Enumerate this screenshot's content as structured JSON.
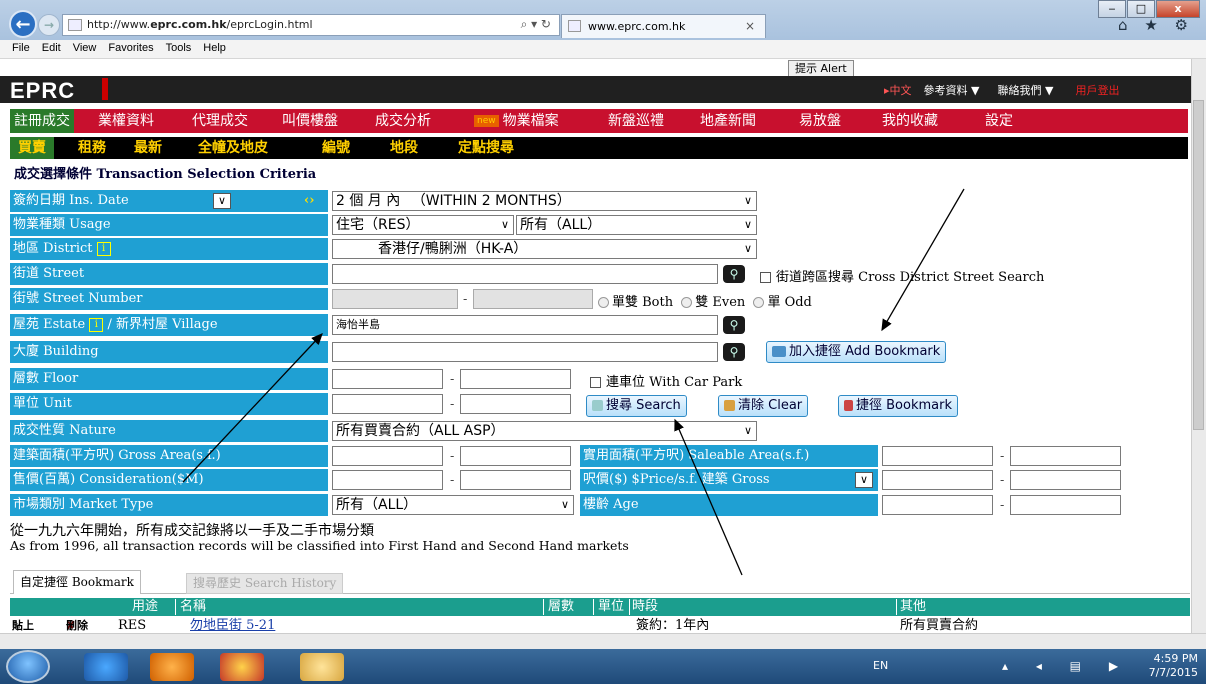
{
  "browser": {
    "url_prefix": "http://www.",
    "url_domain": "eprc.com.hk",
    "url_path": "/eprcLogin.html",
    "search_glyph": "⌕ ▾ ↻",
    "tab_title": "www.eprc.com.hk",
    "tab_close": "×",
    "menu": [
      "File",
      "Edit",
      "View",
      "Favorites",
      "Tools",
      "Help"
    ],
    "window_buttons": [
      "‒",
      "□",
      "x"
    ],
    "toolbar_icons": "⌂ ★ ⚙"
  },
  "header": {
    "logo": "EPRC",
    "alert_button": "提示 Alert",
    "lang_link": "▸中文",
    "ref_menu": "參考資料 ▼",
    "contact_menu": "聯絡我們 ▼",
    "logout": "用戶登出"
  },
  "nav1": {
    "new_badge": "new",
    "items": [
      "註冊成交",
      "業權資料",
      "代理成交",
      "叫價樓盤",
      "成交分析",
      "物業檔案",
      "新盤巡禮",
      "地產新聞",
      "易放盤",
      "我的收藏",
      "設定"
    ]
  },
  "nav2": {
    "items": [
      "買賣",
      "租務",
      "最新",
      "全幢及地皮",
      "編號",
      "地段",
      "定點搜尋"
    ]
  },
  "criteria_title": "成交選擇條件 Transaction Selection Criteria",
  "form": {
    "date_label": "簽約日期 Ins. Date",
    "date_value": "2 個 月 內 　（WITHIN 2 MONTHS）",
    "usage_label": "物業種類 Usage",
    "usage_value1": "住宅（RES）",
    "usage_value2": "所有（ALL）",
    "district_label": "地區 District",
    "district_value": "香港仔/鴨脷洲（HK-A）",
    "street_label": "街道 Street",
    "cross_district": "街道跨區搜尋 Cross District Street Search",
    "street_no_label": "街號 Street Number",
    "radio_both": "單雙 Both",
    "radio_even": "雙 Even",
    "radio_odd": "單 Odd",
    "estate_label_a": "屋苑 Estate",
    "estate_label_b": "/ 新界村屋 Village",
    "estate_value": "海怡半島",
    "building_label": "大廈 Building",
    "add_bookmark": "加入捷徑 Add Bookmark",
    "floor_label": "層數 Floor",
    "car_park": "連車位 With Car Park",
    "unit_label": "單位 Unit",
    "search_btn": "搜尋 Search",
    "clear_btn": "清除 Clear",
    "bookmark_btn": "捷徑 Bookmark",
    "nature_label": "成交性質 Nature",
    "nature_value": "所有買賣合約（ALL ASP）",
    "gross_label": "建築面積(平方呎) Gross Area(s.f.)",
    "saleable_label": "實用面積(平方呎) Saleable Area(s.f.)",
    "consideration_label": "售價(百萬) Consideration($M)",
    "price_label": "呎價($) $Price/s.f. 建築 Gross",
    "market_label": "市場類別 Market Type",
    "market_value": "所有（ALL）",
    "age_label": "樓齡 Age",
    "dash": "-",
    "info_icon_text": "i",
    "arrow_glyph": "∨",
    "swap_glyph": "‹›"
  },
  "note_zh": "從一九九六年開始，所有成交記錄將以一手及二手市場分類",
  "note_en": "As from 1996, all transaction records will be classified into First Hand and Second Hand markets",
  "tabs": {
    "bookmark": "自定捷徑 Bookmark",
    "history": "搜尋歷史 Search History"
  },
  "table": {
    "headers": [
      "用途",
      "名稱",
      "層數",
      "單位",
      "時段",
      "其他"
    ],
    "row": {
      "paste": "貼上",
      "delete": "刪除",
      "usage": "RES",
      "name": "勿地臣街 5-21",
      "period": "簽約：1年內",
      "other": "所有買賣合約"
    }
  },
  "taskbar": {
    "lang": "EN",
    "time": "4:59 PM",
    "date": "7/7/2015",
    "tray_icons": "▴ ◂ ▤ ▶"
  },
  "colors": {
    "label_blue": "#1fa0d3",
    "nav_red": "#c8102e",
    "header_black": "#202020",
    "table_teal": "#1b9e8e"
  }
}
